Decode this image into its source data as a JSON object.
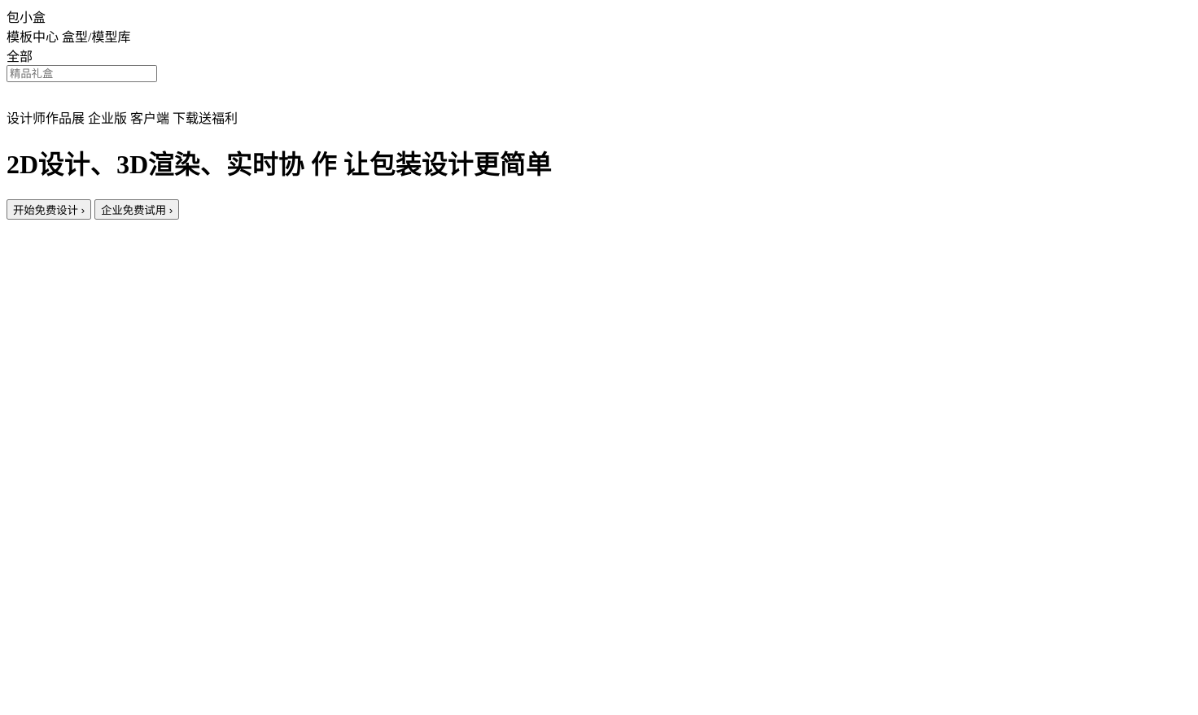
{
  "brand": {
    "name": "包小盒",
    "accent": "#f5762b"
  },
  "nav": {
    "left": [
      {
        "label": "模板中心"
      },
      {
        "label": "盒型/模型库"
      }
    ],
    "right": [
      {
        "label": "设计师作品展"
      },
      {
        "label": "企业版"
      },
      {
        "label": "客户端"
      }
    ],
    "client_badge": "下载送福利"
  },
  "search": {
    "category": "全部",
    "placeholder": "精品礼盒",
    "icon": "search-icon",
    "button_color": "#fb7820"
  },
  "hero": {
    "headline_line1": "2D设计、3D渲染、实时协",
    "headline_line2": "作 让包装设计更简单",
    "primary_button": "开始免费设计",
    "secondary_button": "企业免费试用",
    "chevron": "›",
    "gradient_start": "#ff6c45",
    "gradient_end": "#ffad78",
    "illustration": "shopping-bag"
  }
}
